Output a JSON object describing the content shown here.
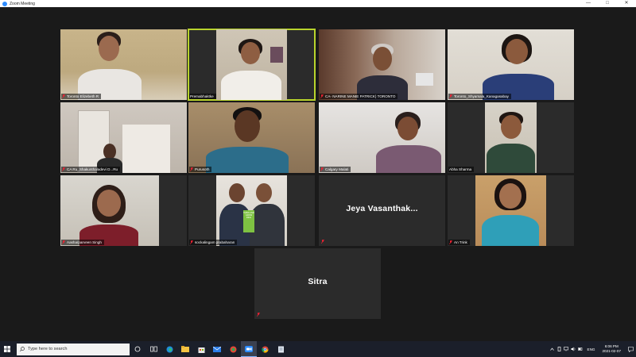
{
  "window": {
    "title": "Zoom Meeting",
    "controls": [
      "—",
      "□",
      "✕"
    ]
  },
  "participants": [
    {
      "name": "Toronto Elizebeth R",
      "video": true,
      "active": false
    },
    {
      "name": "Premabhaktke",
      "video": true,
      "active": true
    },
    {
      "name": "CA- NARINE MANIE PATRICK) TORONTO",
      "video": true,
      "active": false
    },
    {
      "name": "Toronto_Shyamala_Kanagasabay",
      "video": true,
      "active": false
    },
    {
      "name": "CA Ru_Shakunthaladevi D...Ru",
      "video": true,
      "active": false
    },
    {
      "name": "Purusoth",
      "video": true,
      "active": false
    },
    {
      "name": "Calgary Malati",
      "video": true,
      "active": false
    },
    {
      "name": "Abha Sharma",
      "video": true,
      "active": false
    },
    {
      "name": "Aasha/parveen Singh",
      "video": true,
      "active": false
    },
    {
      "name": "sockalingam prabaharan",
      "video": true,
      "active": false
    },
    {
      "name": "Jeya  Vasanthak...",
      "video": false,
      "active": false
    },
    {
      "name": "An Trink",
      "video": true,
      "active": false
    },
    {
      "name": "Sitra",
      "video": false,
      "active": false
    }
  ],
  "book_cover_text": "THINK AND GROW RICH",
  "taskbar": {
    "search_placeholder": "Type here to search",
    "language": "ENG",
    "time": "6:06 PM",
    "date": "2021-02-07"
  }
}
